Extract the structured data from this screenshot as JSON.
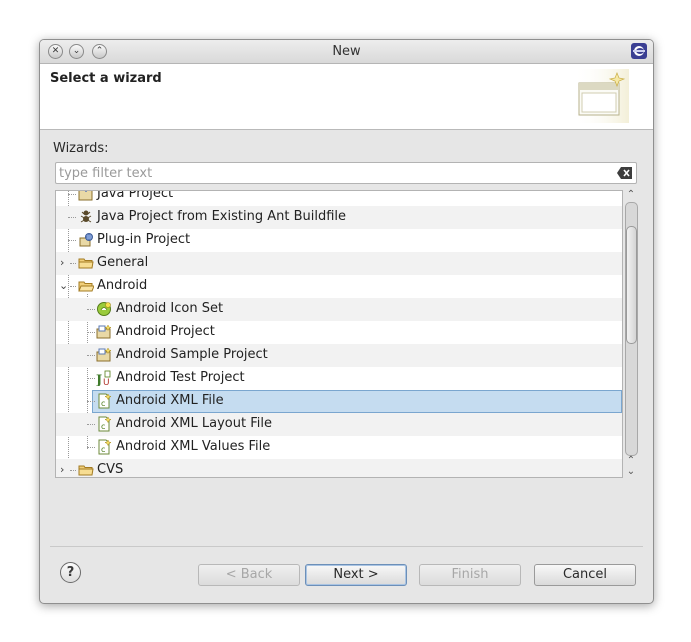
{
  "window": {
    "title": "New",
    "header_title": "Select a wizard",
    "wizards_label": "Wizards:"
  },
  "filter": {
    "placeholder": "type filter text",
    "value": ""
  },
  "tree": {
    "items": [
      {
        "label": "Java Project",
        "icon": "java-project-icon",
        "level": 1
      },
      {
        "label": "Java Project from Existing Ant Buildfile",
        "icon": "ant-project-icon",
        "level": 1
      },
      {
        "label": "Plug-in Project",
        "icon": "plugin-project-icon",
        "level": 1
      },
      {
        "label": "General",
        "icon": "folder-icon",
        "level": 0,
        "expanded": false
      },
      {
        "label": "Android",
        "icon": "folder-icon",
        "level": 0,
        "expanded": true
      },
      {
        "label": "Android Icon Set",
        "icon": "android-icon-set-icon",
        "level": 1
      },
      {
        "label": "Android Project",
        "icon": "android-project-icon",
        "level": 1
      },
      {
        "label": "Android Sample Project",
        "icon": "android-sample-project-icon",
        "level": 1
      },
      {
        "label": "Android Test Project",
        "icon": "android-test-project-icon",
        "level": 1
      },
      {
        "label": "Android XML File",
        "icon": "android-xml-file-icon",
        "level": 1,
        "selected": true
      },
      {
        "label": "Android XML Layout File",
        "icon": "android-xml-file-icon",
        "level": 1
      },
      {
        "label": "Android XML Values File",
        "icon": "android-xml-file-icon",
        "level": 1
      },
      {
        "label": "CVS",
        "icon": "folder-icon",
        "level": 0,
        "expanded": false
      }
    ]
  },
  "buttons": {
    "help": "?",
    "back": "< Back",
    "next": "Next >",
    "finish": "Finish",
    "cancel": "Cancel"
  },
  "colors": {
    "selection": "#c5dcf0",
    "selection_border": "#7aa6cf",
    "eclipse_brand": "#3b3f93"
  }
}
